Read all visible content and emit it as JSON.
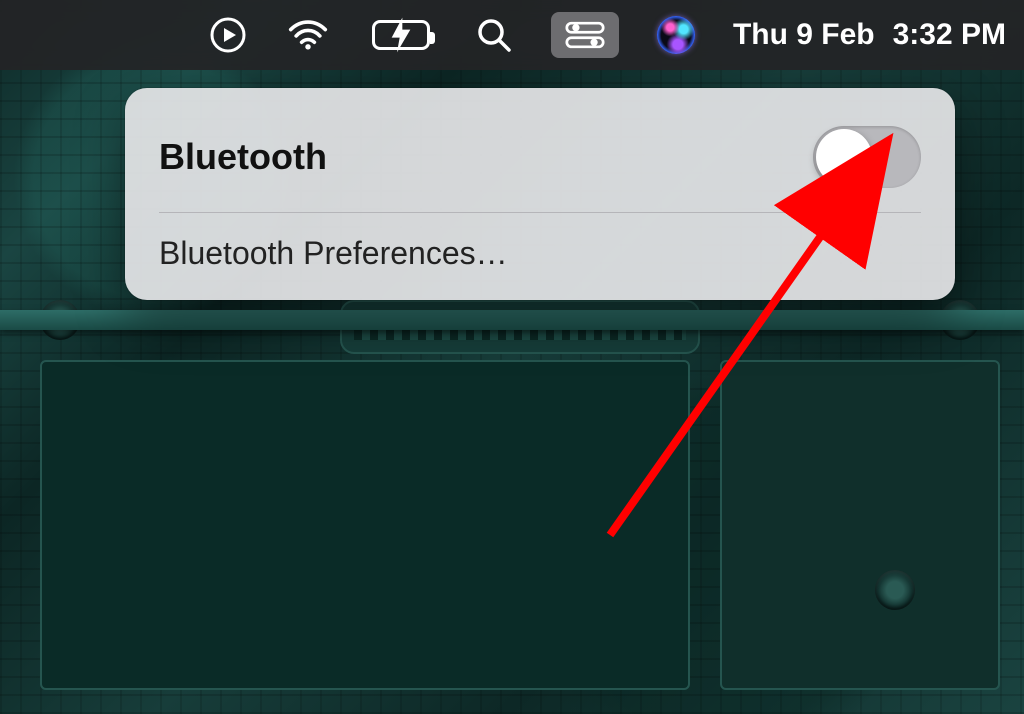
{
  "menubar": {
    "icons": {
      "play": "play-icon",
      "wifi": "wifi-icon",
      "battery": "battery-charging-icon",
      "search": "search-icon",
      "control_center": "control-center-icon",
      "siri": "siri-icon"
    },
    "date": "Thu 9 Feb",
    "time": "3:32 PM"
  },
  "panel": {
    "title": "Bluetooth",
    "toggle_state": "off",
    "preferences_label": "Bluetooth Preferences…"
  },
  "annotation": {
    "arrow_color": "#ff0000"
  }
}
